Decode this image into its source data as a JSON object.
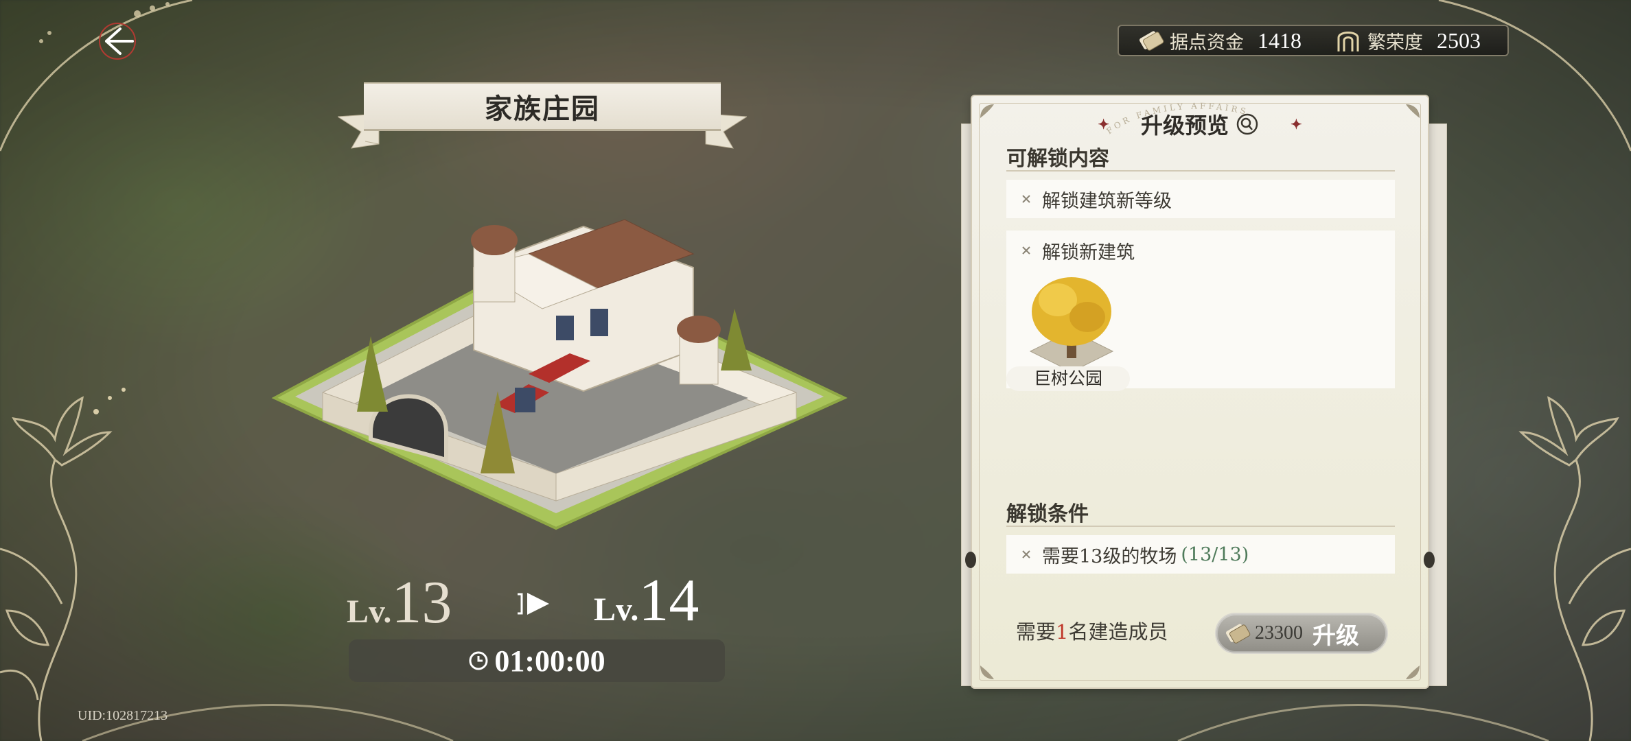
{
  "header": {
    "back_icon": "back-arrow-icon",
    "resources": [
      {
        "icon": "fund-scroll-icon",
        "label": "据点资金",
        "value": "1418"
      },
      {
        "icon": "prosperity-arch-icon",
        "label": "繁荣度",
        "value": "2503"
      }
    ]
  },
  "building": {
    "title": "家族庄园",
    "current_level_prefix": "Lv.",
    "current_level": "13",
    "next_level_prefix": "Lv.",
    "next_level": "14",
    "timer": "01:00:00"
  },
  "uid": "UID:102817213",
  "panel": {
    "arc_text": "FOR FAMILY AFFAIRS",
    "title": "升级预览",
    "unlock_heading": "可解锁内容",
    "unlock_items": [
      {
        "text": "解锁建筑新等级"
      },
      {
        "text": "解锁新建筑"
      }
    ],
    "new_building_name": "巨树公园",
    "condition_heading": "解锁条件",
    "condition_text": "需要13级的牧场",
    "condition_progress": "(13/13)",
    "builder_prefix": "需要",
    "builder_count": "1",
    "builder_suffix": "名建造成员",
    "upgrade_cost": "23300",
    "upgrade_label": "升级"
  },
  "colors": {
    "accent_red": "#c0392b",
    "progress_green": "#4e7a5a",
    "panel_bg": "#f0eee6"
  }
}
